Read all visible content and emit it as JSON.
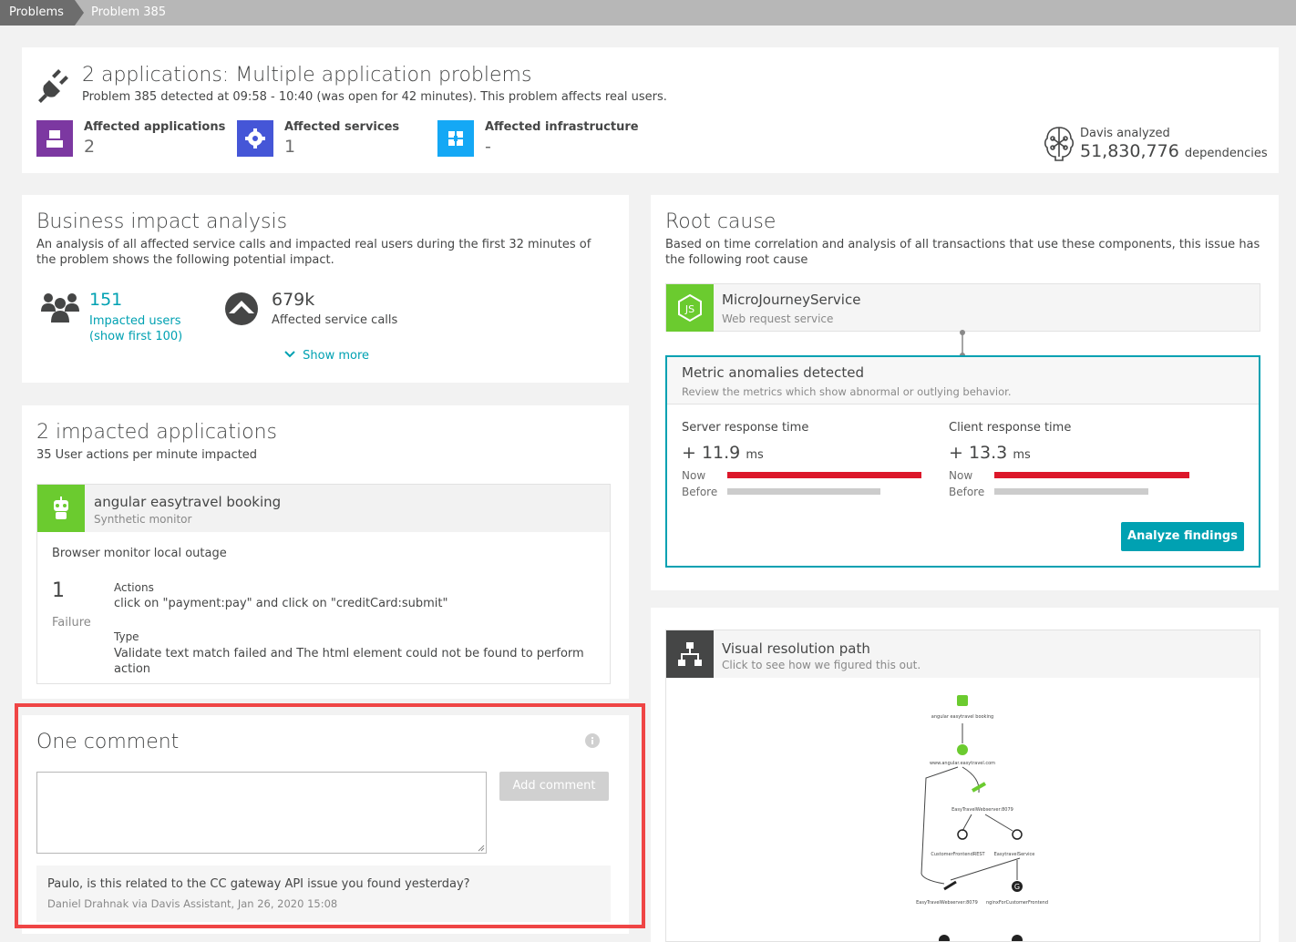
{
  "breadcrumb": {
    "root": "Problems",
    "current": "Problem 385"
  },
  "header": {
    "title": "2 applications: Multiple application problems",
    "subtitle": "Problem 385 detected at 09:58 - 10:40 (was open for 42 minutes). This problem affects real users.",
    "affected": [
      {
        "label": "Affected applications",
        "value": "2",
        "color": "#7c38a1"
      },
      {
        "label": "Affected services",
        "value": "1",
        "color": "#4556d7"
      },
      {
        "label": "Affected infrastructure",
        "value": "-",
        "color": "#14a8f5"
      }
    ],
    "davis": {
      "label": "Davis analyzed",
      "value": "51,830,776",
      "unit": "dependencies"
    }
  },
  "business": {
    "title": "Business impact analysis",
    "description": "An analysis of all affected service calls and impacted real users during the first 32 minutes of the problem shows the following potential impact.",
    "users_value": "151",
    "users_label": "Impacted users (show first 100)",
    "calls_value": "679k",
    "calls_label": "Affected service calls",
    "show_more": "Show more"
  },
  "apps": {
    "title": "2 impacted applications",
    "subtitle": "35 User actions per minute impacted",
    "app_name": "angular easytravel booking",
    "app_type": "Synthetic monitor",
    "outage": "Browser monitor local outage",
    "count": "1",
    "count_label": "Failure",
    "actions_label": "Actions",
    "actions_value": "click on \"payment:pay\" and click on \"creditCard:submit\"",
    "type_label": "Type",
    "type_value": "Validate text match failed and The html element could not be found to perform action"
  },
  "comments": {
    "title": "One comment",
    "add_label": "Add comment",
    "items": [
      {
        "text": "Paulo, is this related to the CC gateway API issue you found yesterday?",
        "meta": "Daniel Drahnak via Davis Assistant, Jan 26, 2020 15:08"
      }
    ]
  },
  "root": {
    "title": "Root cause",
    "description": "Based on time correlation and analysis of all transactions that use these components, this issue has the following root cause",
    "service_name": "MicroJourneyService",
    "service_type": "Web request service",
    "anomaly_title": "Metric anomalies detected",
    "anomaly_sub": "Review the metrics which show abnormal or outlying behavior.",
    "metrics": [
      {
        "name": "Server response time",
        "delta": "+ 11.9",
        "unit": "ms",
        "now_label": "Now",
        "before_label": "Before",
        "now_ratio": 1.0,
        "before_ratio": 0.79
      },
      {
        "name": "Client response time",
        "delta": "+ 13.3",
        "unit": "ms",
        "now_label": "Now",
        "before_label": "Before",
        "now_ratio": 1.0,
        "before_ratio": 0.79
      }
    ],
    "analyze_label": "Analyze findings"
  },
  "visual": {
    "title": "Visual resolution path",
    "subtitle": "Click to see how we figured this out.",
    "nodes": [
      {
        "label": "angular easytravel booking"
      },
      {
        "label": "www.angular.easytravel.com"
      },
      {
        "label": "EasyTravelWebserver:8079"
      },
      {
        "label": "CustomerFrontendREST"
      },
      {
        "label": "EasytravelService"
      },
      {
        "label": "EasyTravelWebserver:8079"
      },
      {
        "label": "nginxForCustomerFrontend"
      }
    ]
  },
  "colors": {
    "accent": "#00a1b2",
    "alert": "#dc172a",
    "highlight": "#ef4545"
  }
}
